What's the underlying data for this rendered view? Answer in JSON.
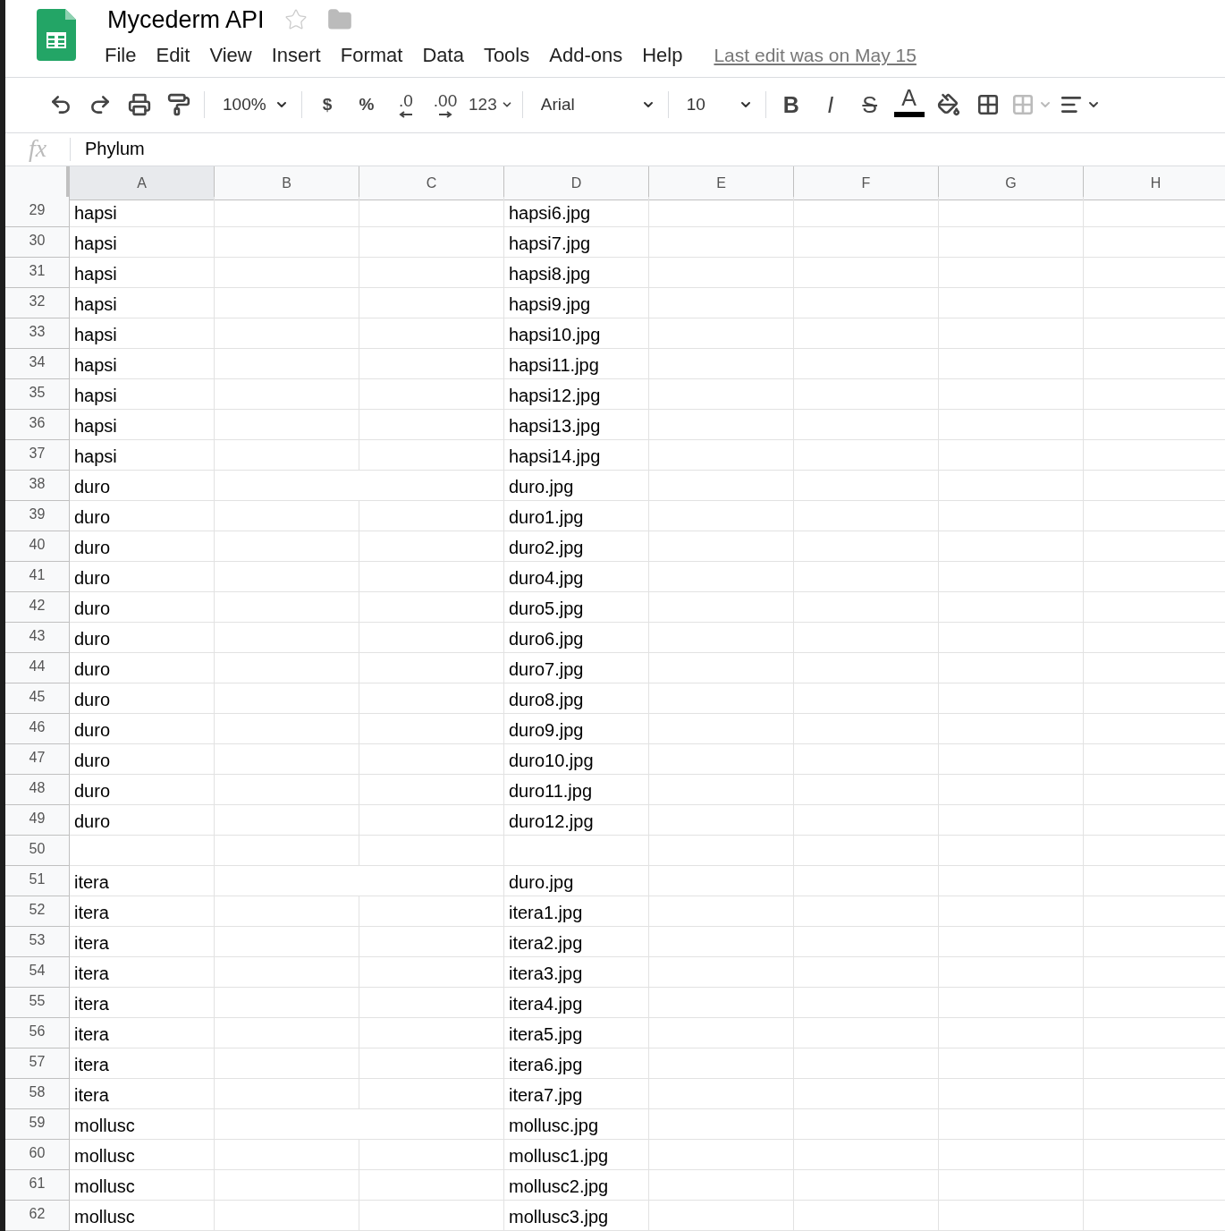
{
  "document": {
    "title": "Mycederm API",
    "starred": false
  },
  "menu": [
    "File",
    "Edit",
    "View",
    "Insert",
    "Format",
    "Data",
    "Tools",
    "Add-ons",
    "Help"
  ],
  "last_edit": "Last edit was on May 15",
  "toolbar": [
    {
      "kind": "undo"
    },
    {
      "kind": "redo"
    },
    {
      "kind": "print"
    },
    {
      "kind": "paint"
    },
    {
      "kind": "sep"
    },
    {
      "kind": "zoom",
      "label": "100%"
    },
    {
      "kind": "sep"
    },
    {
      "kind": "text",
      "label": "$"
    },
    {
      "kind": "text",
      "label": "%"
    },
    {
      "kind": "decrease_decimal",
      "label": ".0"
    },
    {
      "kind": "increase_decimal",
      "label": ".00"
    },
    {
      "kind": "caret",
      "label": "123"
    },
    {
      "kind": "sep"
    },
    {
      "kind": "font",
      "label": "Arial"
    },
    {
      "kind": "sep"
    },
    {
      "kind": "size",
      "label": "10"
    },
    {
      "kind": "sep"
    },
    {
      "kind": "bold",
      "label": "B"
    },
    {
      "kind": "italic",
      "label": "I"
    },
    {
      "kind": "strike",
      "label": "S"
    },
    {
      "kind": "textcolor",
      "label": "A",
      "color": "#000000"
    },
    {
      "kind": "fill"
    },
    {
      "kind": "borders"
    },
    {
      "kind": "merge",
      "disabled": true
    },
    {
      "kind": "align"
    }
  ],
  "formula_bar": {
    "label": "fx",
    "value": "Phylum"
  },
  "columns": [
    {
      "label": "A",
      "selected": true
    },
    {
      "label": "B",
      "selected": false
    },
    {
      "label": "C",
      "selected": false
    },
    {
      "label": "D",
      "selected": false
    },
    {
      "label": "E",
      "selected": false
    },
    {
      "label": "F",
      "selected": false
    },
    {
      "label": "G",
      "selected": false
    },
    {
      "label": "H",
      "selected": false
    }
  ],
  "rows": [
    {
      "number": "29",
      "a": "hapsi",
      "d": "hapsi6.jpg",
      "merged_bc": false
    },
    {
      "number": "30",
      "a": "hapsi",
      "d": "hapsi7.jpg",
      "merged_bc": false
    },
    {
      "number": "31",
      "a": "hapsi",
      "d": "hapsi8.jpg",
      "merged_bc": false
    },
    {
      "number": "32",
      "a": "hapsi",
      "d": "hapsi9.jpg",
      "merged_bc": false
    },
    {
      "number": "33",
      "a": "hapsi",
      "d": "hapsi10.jpg",
      "merged_bc": false
    },
    {
      "number": "34",
      "a": "hapsi",
      "d": "hapsi11.jpg",
      "merged_bc": false
    },
    {
      "number": "35",
      "a": "hapsi",
      "d": "hapsi12.jpg",
      "merged_bc": false
    },
    {
      "number": "36",
      "a": "hapsi",
      "d": "hapsi13.jpg",
      "merged_bc": false
    },
    {
      "number": "37",
      "a": "hapsi",
      "d": "hapsi14.jpg",
      "merged_bc": false
    },
    {
      "number": "38",
      "a": "duro",
      "d": "duro.jpg",
      "merged_bc": true
    },
    {
      "number": "39",
      "a": "duro",
      "d": "duro1.jpg",
      "merged_bc": false
    },
    {
      "number": "40",
      "a": "duro",
      "d": "duro2.jpg",
      "merged_bc": false
    },
    {
      "number": "41",
      "a": "duro",
      "d": "duro4.jpg",
      "merged_bc": false
    },
    {
      "number": "42",
      "a": "duro",
      "d": "duro5.jpg",
      "merged_bc": false
    },
    {
      "number": "43",
      "a": "duro",
      "d": "duro6.jpg",
      "merged_bc": false
    },
    {
      "number": "44",
      "a": "duro",
      "d": "duro7.jpg",
      "merged_bc": false
    },
    {
      "number": "45",
      "a": "duro",
      "d": "duro8.jpg",
      "merged_bc": false
    },
    {
      "number": "46",
      "a": "duro",
      "d": "duro9.jpg",
      "merged_bc": false
    },
    {
      "number": "47",
      "a": "duro",
      "d": "duro10.jpg",
      "merged_bc": false
    },
    {
      "number": "48",
      "a": "duro",
      "d": "duro11.jpg",
      "merged_bc": false
    },
    {
      "number": "49",
      "a": "duro",
      "d": "duro12.jpg",
      "merged_bc": false
    },
    {
      "number": "50",
      "merged_bc": false
    },
    {
      "number": "51",
      "a": "itera",
      "d": "duro.jpg",
      "merged_bc": true
    },
    {
      "number": "52",
      "a": "itera",
      "d": "itera1.jpg",
      "merged_bc": false
    },
    {
      "number": "53",
      "a": "itera",
      "d": "itera2.jpg",
      "merged_bc": false
    },
    {
      "number": "54",
      "a": "itera",
      "d": "itera3.jpg",
      "merged_bc": false
    },
    {
      "number": "55",
      "a": "itera",
      "d": "itera4.jpg",
      "merged_bc": false
    },
    {
      "number": "56",
      "a": "itera",
      "d": "itera5.jpg",
      "merged_bc": false
    },
    {
      "number": "57",
      "a": "itera",
      "d": "itera6.jpg",
      "merged_bc": false
    },
    {
      "number": "58",
      "a": "itera",
      "d": "itera7.jpg",
      "merged_bc": false
    },
    {
      "number": "59",
      "a": "mollusc",
      "d": "mollusc.jpg",
      "merged_bc": true
    },
    {
      "number": "60",
      "a": "mollusc",
      "d": "mollusc1.jpg",
      "merged_bc": false
    },
    {
      "number": "61",
      "a": "mollusc",
      "d": "mollusc2.jpg",
      "merged_bc": false
    },
    {
      "number": "62",
      "a": "mollusc",
      "d": "mollusc3.jpg",
      "merged_bc": false
    }
  ]
}
